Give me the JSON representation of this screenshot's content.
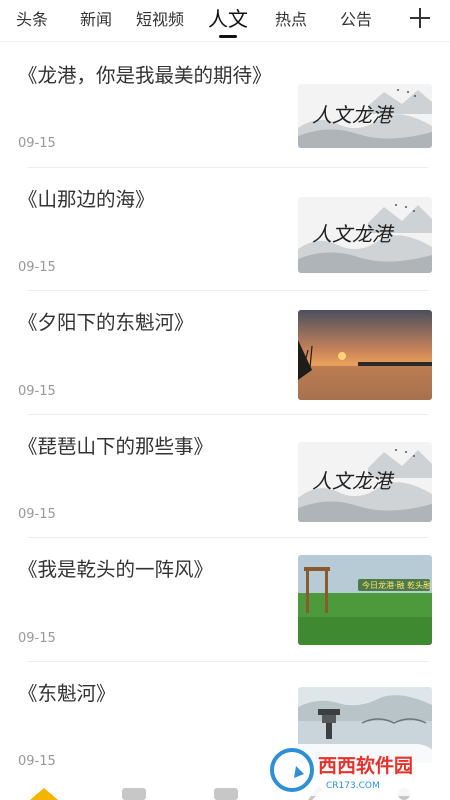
{
  "tabs": [
    {
      "label": "头条"
    },
    {
      "label": "新闻"
    },
    {
      "label": "短视频"
    },
    {
      "label": "人文",
      "active": true
    },
    {
      "label": "热点"
    },
    {
      "label": "公告"
    }
  ],
  "articles": [
    {
      "title": "《龙港，你是我最美的期待》",
      "date": "09-15",
      "thumb": "人文龙港"
    },
    {
      "title": "《山那边的海》",
      "date": "09-15",
      "thumb": "人文龙港"
    },
    {
      "title": "《夕阳下的东魁河》",
      "date": "09-15",
      "thumb": "sunset-river"
    },
    {
      "title": "《琵琶山下的那些事》",
      "date": "09-15",
      "thumb": "人文龙港"
    },
    {
      "title": "《我是乾头的一阵风》",
      "date": "09-15",
      "thumb": "今日龙港·融 乾头融合"
    },
    {
      "title": "《东魁河》",
      "date": "09-15",
      "thumb": "river-pavilion"
    }
  ],
  "watermark": {
    "brand": "西西软件园",
    "url": "CR173.COM"
  },
  "icons": [
    "home-icon",
    "image-icon",
    "video-icon",
    "pen-icon",
    "user-icon",
    "plus-icon"
  ],
  "colors": {
    "accent": "#f4b400",
    "text": "#333333",
    "date": "#999999"
  }
}
